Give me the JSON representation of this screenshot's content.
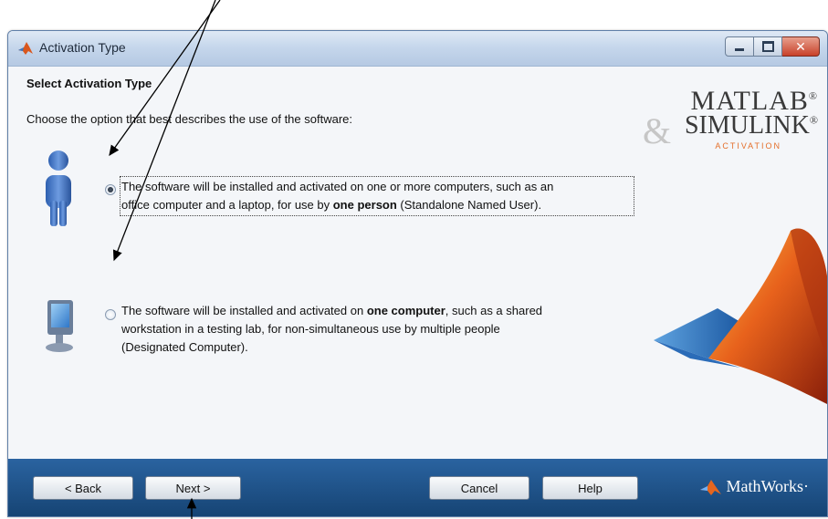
{
  "window": {
    "title": "Activation Type",
    "title_icon": "matlab-icon",
    "controls": {
      "minimize_icon": "minimize-icon",
      "maximize_icon": "maximize-icon",
      "close_icon": "close-icon",
      "close_glyph": "✕"
    }
  },
  "content": {
    "heading": "Select Activation Type",
    "instruction": "Choose the option that best describes the use of the software:",
    "options": [
      {
        "icon": "person-icon",
        "selected": true,
        "line1": "The software will be installed and activated on one or more computers, such as an",
        "line2_pre": "office computer and a laptop, for use by ",
        "line2_bold": "one person",
        "line2_post": " (Standalone Named User)."
      },
      {
        "icon": "computer-icon",
        "selected": false,
        "line1_pre": "The software will be installed and activated on ",
        "line1_bold": "one computer",
        "line1_post": ", such as a shared",
        "line2": "workstation in a testing lab, for non-simultaneous use by multiple people",
        "line3": "(Designated Computer)."
      }
    ]
  },
  "logo": {
    "matlab": "MATLAB",
    "matlab_mark": "®",
    "amp": "&",
    "simulink": "SIMULINK",
    "simulink_mark": "®",
    "sub": "ACTIVATION"
  },
  "footer": {
    "back": "< Back",
    "next": "Next >",
    "cancel": "Cancel",
    "help": "Help",
    "brand": "MathWorks",
    "brand_mark": "·"
  },
  "colors": {
    "footer": "#1c4f87",
    "accent_orange": "#e46f2a",
    "titlebar": "#c6d7ec"
  }
}
